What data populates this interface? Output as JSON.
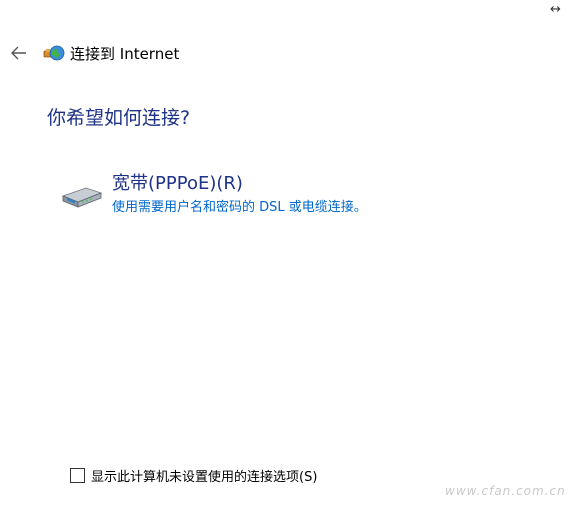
{
  "window": {
    "resize_glyph": "↔"
  },
  "header": {
    "back_icon": "back-arrow-icon",
    "wizard_icon": "network-globe-icon",
    "title": "连接到 Internet"
  },
  "main": {
    "question": "你希望如何连接?",
    "options": [
      {
        "icon": "broadband-modem-icon",
        "title": "宽带(PPPoE)(R)",
        "description": "使用需要用户名和密码的 DSL 或电缆连接。"
      }
    ]
  },
  "footer": {
    "checkbox_checked": false,
    "checkbox_label": "显示此计算机未设置使用的连接选项(S)"
  },
  "watermark": {
    "text": "www.cfan.com.cn"
  },
  "colors": {
    "heading": "#1e3287",
    "link_desc": "#0066cc",
    "background": "#ffffff"
  }
}
